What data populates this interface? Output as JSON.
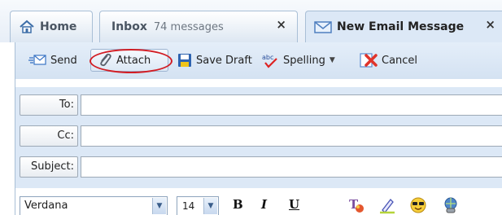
{
  "tabs": {
    "home": {
      "label": "Home"
    },
    "inbox": {
      "label": "Inbox",
      "count": "74 messages",
      "close": "×"
    },
    "compose": {
      "label": "New Email Message",
      "close": "×"
    }
  },
  "toolbar": {
    "send": "Send",
    "attach": "Attach",
    "save_draft": "Save Draft",
    "spelling": "Spelling",
    "cancel": "Cancel"
  },
  "fields": {
    "to_label": "To:",
    "to_value": "",
    "cc_label": "Cc:",
    "cc_value": "",
    "subject_label": "Subject:",
    "subject_value": ""
  },
  "format": {
    "font": "Verdana",
    "size": "14",
    "bold": "B",
    "italic": "I",
    "underline": "U"
  },
  "icons": {
    "home": "home-icon",
    "envelope": "envelope-icon",
    "send": "send-icon",
    "attach": "paperclip-icon",
    "save": "floppy-disk-icon",
    "spelling": "spellcheck-icon",
    "cancel": "cancel-icon",
    "text_color": "text-color-icon",
    "highlight": "highlighter-icon",
    "emoticon": "emoticon-icon",
    "link": "hyperlink-icon"
  },
  "colors": {
    "highlight_ring": "#d21d24",
    "toolbar_bg": "#dce8f6",
    "tab_border": "#a9bfd6"
  }
}
